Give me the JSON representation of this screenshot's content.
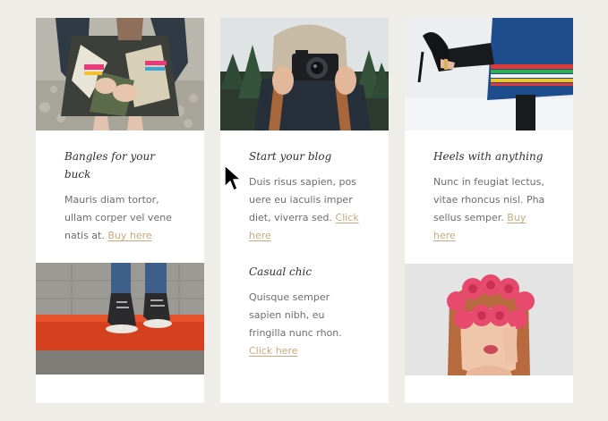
{
  "cards": [
    {
      "title_line1": "Bangles for your",
      "title_line2": "buck",
      "body_line1": "Mauris diam tortor,",
      "body_line2": "ullam corper vel vene",
      "body_line3": "natis at.",
      "link_label": "Buy here",
      "image_alt": "woman-with-bangles-photo",
      "image2_alt": "sneakers-on-red-curb-photo"
    },
    {
      "title_line1": "Start your blog",
      "body_line1": "Duis risus sapien, pos",
      "body_line2": "uere eu iaculis imper",
      "body_line3": "diet, viverra sed.",
      "link_line1": "Click",
      "link_line2": "here",
      "image_alt": "person-with-camera-photo"
    },
    {
      "title_line1": "Casual chic",
      "body_line1": "Quisque semper",
      "body_line2": "sapien nibh, eu",
      "body_line3": "fringilla nunc rhon.",
      "link_label": "Click here"
    },
    {
      "title_line1": "Heels with anything",
      "body_line1": "Nunc in feugiat lectus,",
      "body_line2": "vitae rhoncus nisl. Pha",
      "body_line3": "sellus semper.",
      "link_line1": "Buy",
      "link_line2": "here",
      "image_alt": "high-heel-and-skirt-photo",
      "image2_alt": "woman-with-flower-crown-photo"
    }
  ],
  "colors": {
    "page_background": "#eeede8",
    "card_background": "#ffffff",
    "link": "#c9a97b",
    "title": "#2f2f2f",
    "body_text": "#6d6d6d"
  },
  "icons": {
    "cursor": "mouse-pointer-icon"
  }
}
